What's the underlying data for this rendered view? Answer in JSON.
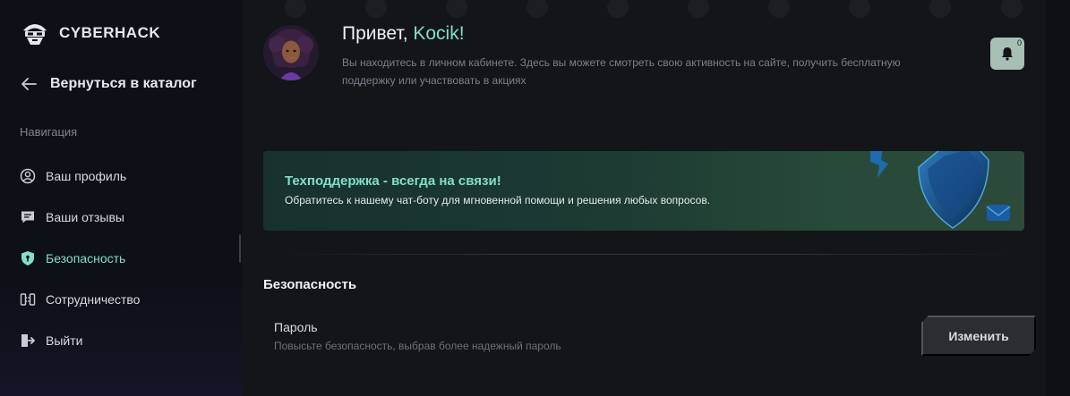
{
  "brand": {
    "name_part1": "CYBER",
    "name_part2": "HACK"
  },
  "sidebar": {
    "back_label": "Вернуться в каталог",
    "nav_heading": "Навигация",
    "items": [
      {
        "label": "Ваш профиль",
        "icon": "user-circle-icon",
        "active": false
      },
      {
        "label": "Ваши отзывы",
        "icon": "comment-icon",
        "active": false
      },
      {
        "label": "Безопасность",
        "icon": "shield-icon",
        "active": true
      },
      {
        "label": "Сотрудничество",
        "icon": "handshake-icon",
        "active": false
      },
      {
        "label": "Выйти",
        "icon": "logout-icon",
        "active": false
      }
    ]
  },
  "header": {
    "greeting_prefix": "Привет, ",
    "user_name": "Kocik!",
    "intro_text": "Вы находитесь в личном кабинете. Здесь вы можете смотреть свою активность на сайте, получить бесплатную поддержку или участвовать в акциях",
    "notification_count": "0"
  },
  "banner": {
    "title": "Техподдержка - всегда на связи!",
    "text": "Обратитесь к нашему чат-боту для мгновенной помощи и решения любых вопросов."
  },
  "security": {
    "section_title": "Безопасность",
    "password_label": "Пароль",
    "password_desc": "Повысьте безопасность, выбрав более надежный пароль",
    "change_button": "Изменить"
  },
  "colors": {
    "accent": "#7fe0c7",
    "background": "#0c0f14",
    "panel": "#131519",
    "button": "#2a2d31",
    "bell": "#a8bfb5"
  }
}
